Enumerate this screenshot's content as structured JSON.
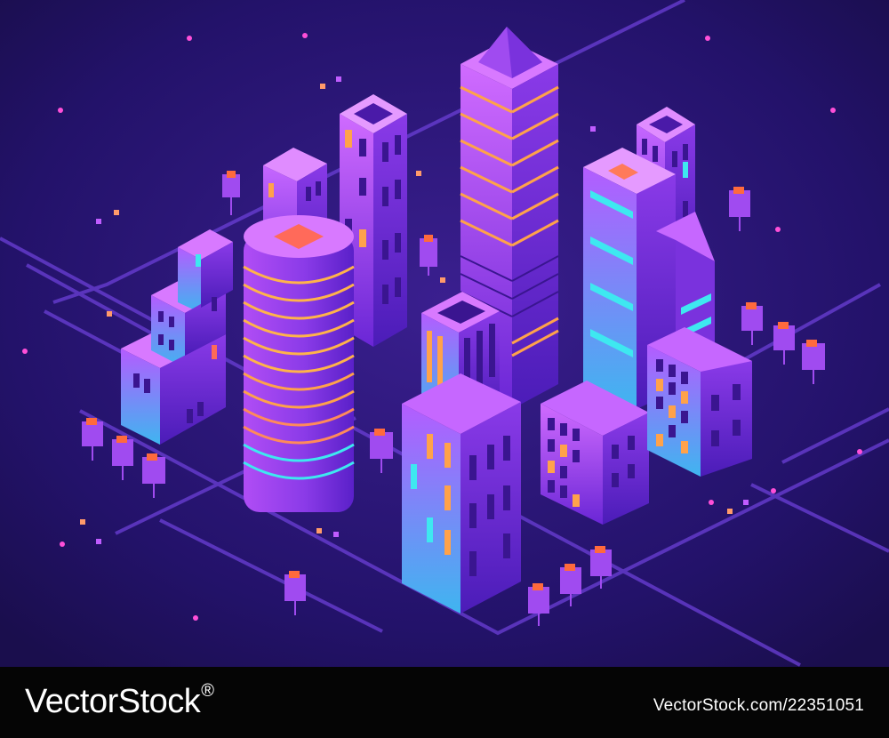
{
  "footer": {
    "brand_prefix": "VectorStock",
    "brand_suffix": "",
    "brand_mark": "®",
    "credit": "VectorStock.com/22351051"
  },
  "colors": {
    "background": "#1b0f4a",
    "footer": "#050505",
    "building_light": "#b25cff",
    "building_dark": "#5a20c9",
    "window_orange": "#ffa24a",
    "window_cyan": "#3ee8f0",
    "tree_top": "#ff6a3d"
  }
}
